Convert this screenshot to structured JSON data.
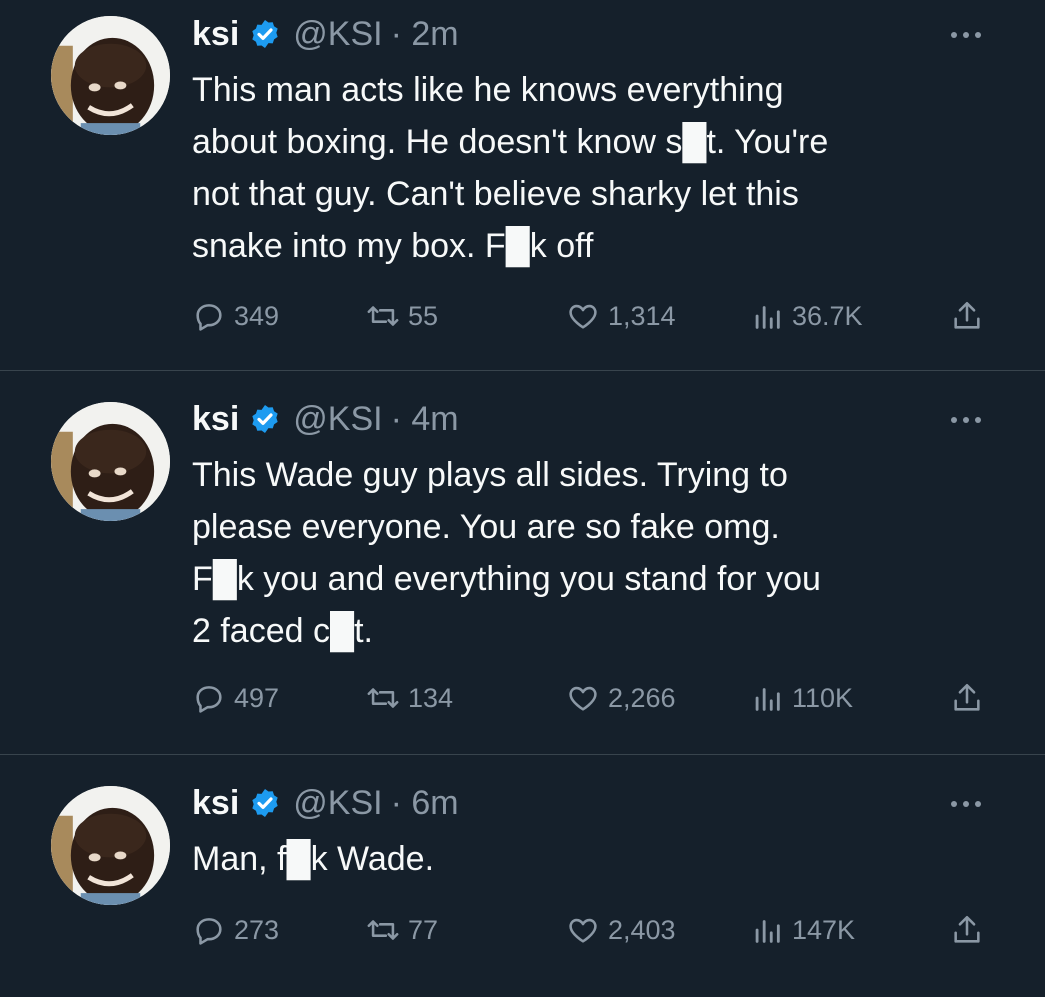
{
  "tweets": [
    {
      "name": "ksi",
      "handle": "@KSI",
      "time": "· 2m",
      "text": "This man acts like he knows everything\nabout boxing. He doesn't know s█t. You're\nnot that guy. Can't believe sharky let this\nsnake into my box. F█k off",
      "replies": "349",
      "retweets": "55",
      "likes": "1,314",
      "views": "36.7K"
    },
    {
      "name": "ksi",
      "handle": "@KSI",
      "time": "· 4m",
      "text": "This Wade guy plays all sides. Trying to\nplease everyone. You are so fake omg.\nF█k you and everything you stand for you\n2 faced c█t.",
      "replies": "497",
      "retweets": "134",
      "likes": "2,266",
      "views": "110K"
    },
    {
      "name": "ksi",
      "handle": "@KSI",
      "time": "· 6m",
      "text": "Man, f█k Wade.",
      "replies": "273",
      "retweets": "77",
      "likes": "2,403",
      "views": "147K"
    }
  ],
  "icons": {
    "reply": "reply-icon",
    "retweet": "retweet-icon",
    "like": "heart-icon",
    "views": "views-icon",
    "share": "share-icon",
    "more": "more-icon",
    "verified": "verified-badge-icon"
  },
  "colors": {
    "background": "#15202b",
    "text": "#f7f9f9",
    "secondary": "#8b98a5",
    "verified": "#1d9bf0",
    "divider": "#38444d"
  }
}
